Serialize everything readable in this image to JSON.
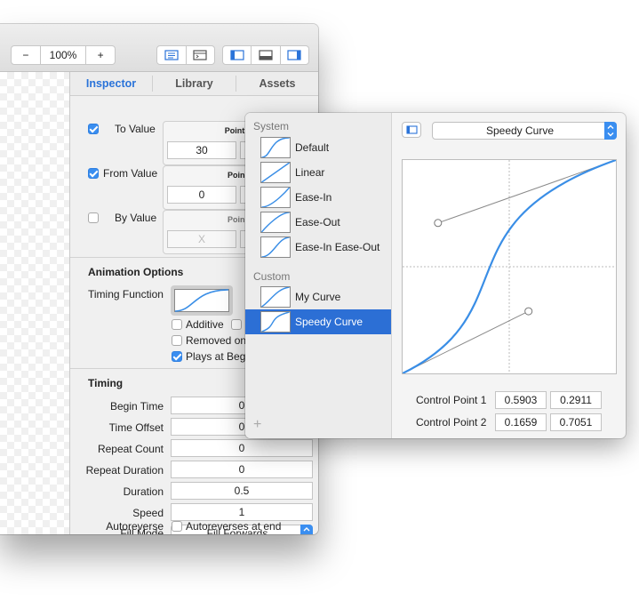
{
  "toolbar": {
    "minus": "−",
    "zoom": "100%",
    "plus": "+"
  },
  "tabs": [
    "Inspector",
    "Library",
    "Assets"
  ],
  "values": {
    "to_value": {
      "label": "To Value",
      "checked": true,
      "type": "Point",
      "x": "30"
    },
    "from_value": {
      "label": "From Value",
      "checked": true,
      "type": "Poin",
      "x": "0"
    },
    "by_value": {
      "label": "By Value",
      "checked": false,
      "type": "Poin",
      "x": "X"
    }
  },
  "animation_options": {
    "title": "Animation Options",
    "timing_function_label": "Timing Function",
    "additive": "Additive",
    "removed_on": "Removed on",
    "plays_at_begin": "Plays at Begi"
  },
  "timing": {
    "title": "Timing",
    "rows": [
      {
        "label": "Begin Time",
        "value": "0"
      },
      {
        "label": "Time Offset",
        "value": "0"
      },
      {
        "label": "Repeat Count",
        "value": "0"
      },
      {
        "label": "Repeat Duration",
        "value": "0"
      },
      {
        "label": "Duration",
        "value": "0.5"
      },
      {
        "label": "Speed",
        "value": "1"
      }
    ],
    "fill_mode_label": "Fill Mode",
    "fill_mode_value": "Fill Forwards",
    "autoreverse_label": "Autoreverse",
    "autoreverse_text": "Autoreverses at end"
  },
  "popover": {
    "system_title": "System",
    "system": [
      "Default",
      "Linear",
      "Ease-In",
      "Ease-Out",
      "Ease-In Ease-Out"
    ],
    "custom_title": "Custom",
    "custom": [
      "My Curve",
      "Speedy Curve"
    ],
    "selected": "Speedy Curve",
    "add": "+",
    "curve_select": "Speedy Curve",
    "cp1_label": "Control Point 1",
    "cp1": [
      "0.5903",
      "0.2911"
    ],
    "cp2_label": "Control Point 2",
    "cp2": [
      "0.1659",
      "0.7051"
    ]
  },
  "colors": {
    "accent": "#2c6fd5",
    "curve": "#3a8ee6"
  }
}
